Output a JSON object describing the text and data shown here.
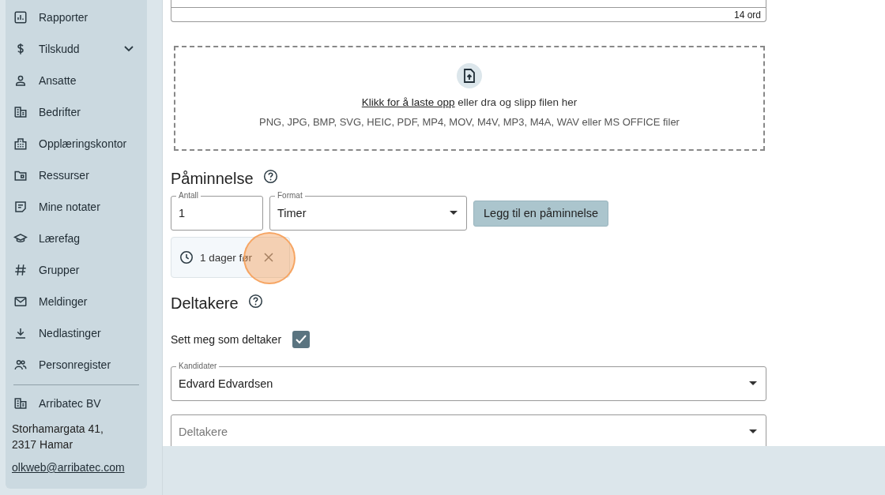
{
  "sidebar": {
    "items": [
      {
        "label": "Rapporter",
        "kind": "link"
      },
      {
        "label": "Tilskudd",
        "kind": "group"
      },
      {
        "label": "Ansatte",
        "kind": "link"
      },
      {
        "label": "Bedrifter",
        "kind": "link"
      },
      {
        "label": "Opplæringskontor",
        "kind": "link"
      },
      {
        "label": "Ressurser",
        "kind": "link"
      },
      {
        "label": "Mine notater",
        "kind": "link"
      },
      {
        "label": "Lærefag",
        "kind": "link"
      },
      {
        "label": "Grupper",
        "kind": "link"
      },
      {
        "label": "Meldinger",
        "kind": "link"
      },
      {
        "label": "Nedlastinger",
        "kind": "link"
      },
      {
        "label": "Personregister",
        "kind": "link"
      }
    ],
    "company": {
      "name": "Arribatec BV",
      "address": "Storhamargata 41, 2317 Hamar",
      "email": "olkweb@arribatec.com"
    }
  },
  "editor": {
    "word_count": "14 ord"
  },
  "upload": {
    "link": "Klikk for å laste opp",
    "text": "eller dra og slipp filen her",
    "formats": "PNG, JPG, BMP, SVG, HEIC, PDF, MP4, MOV, M4V, MP3, M4A, WAV eller MS OFFICE filer"
  },
  "reminder": {
    "title": "Påminnelse",
    "count": {
      "label": "Antall",
      "value": "1"
    },
    "format": {
      "label": "Format",
      "value": "Timer"
    },
    "add_button": "Legg til en påminnelse",
    "items": [
      {
        "label": "1 dager før"
      }
    ]
  },
  "participants": {
    "title": "Deltakere",
    "self": {
      "label": "Sett meg som deltaker",
      "checked": true
    },
    "candidates": {
      "label": "Kandidater",
      "value": "Edvard Edvardsen"
    },
    "participants_field": {
      "placeholder": "Deltakere"
    }
  }
}
